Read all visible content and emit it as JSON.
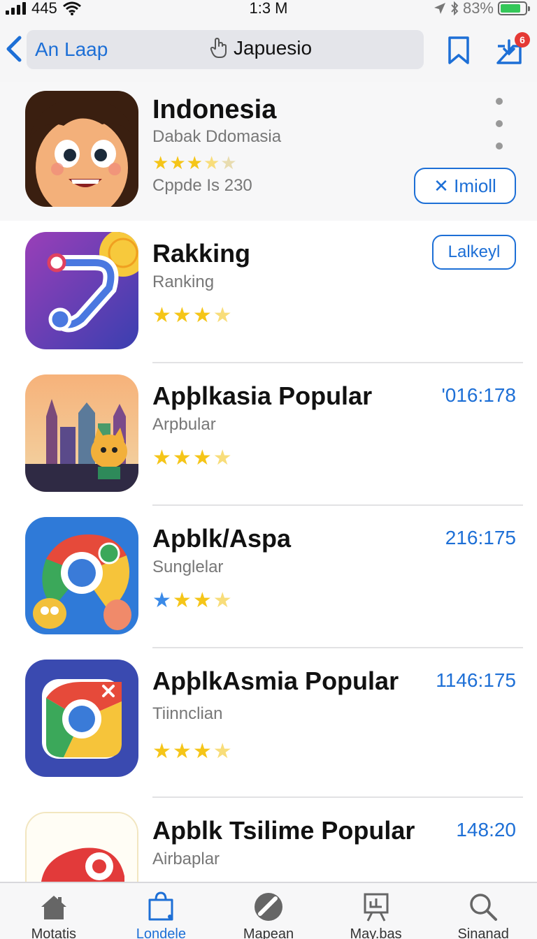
{
  "status_bar": {
    "carrier": "445",
    "time": "1:3 M",
    "battery": "83%",
    "battery_level": 0.83
  },
  "nav": {
    "back_label": "An Laap",
    "search_text": "Japuesio",
    "notification_badge": "6"
  },
  "featured": {
    "title": "Indonesia",
    "subtitle": "Dabak Ddomasia",
    "rating_stars": "★★★★★",
    "meta": "Cppde Is 230",
    "install_label": "✕ Imioll"
  },
  "apps": [
    {
      "title": "Rakking",
      "subtitle": "Ranking",
      "button_label": "Lalkeyl"
    },
    {
      "title": "Apþlkasia Popular",
      "subtitle": "Arpbular",
      "value": "'016:178"
    },
    {
      "title": "Apblk/Aspa",
      "subtitle": "Sunglelar",
      "value": "216:175"
    },
    {
      "title": "ApþlkAsmia Popular",
      "subtitle": "Tiinnclian",
      "value": "1146:175"
    },
    {
      "title": "Apblk Tsilime Popular",
      "subtitle": "Airbaplar",
      "value": "148:20"
    }
  ],
  "tabs": [
    {
      "label": "Motatis",
      "icon": "home-icon"
    },
    {
      "label": "Londele",
      "icon": "bag-icon"
    },
    {
      "label": "Mapean",
      "icon": "compass-icon"
    },
    {
      "label": "May.bas",
      "icon": "board-icon"
    },
    {
      "label": "Sinanad",
      "icon": "search-icon"
    }
  ],
  "colors": {
    "accent": "#1d6fd6",
    "star": "#f5c518",
    "badge": "#e53935"
  }
}
